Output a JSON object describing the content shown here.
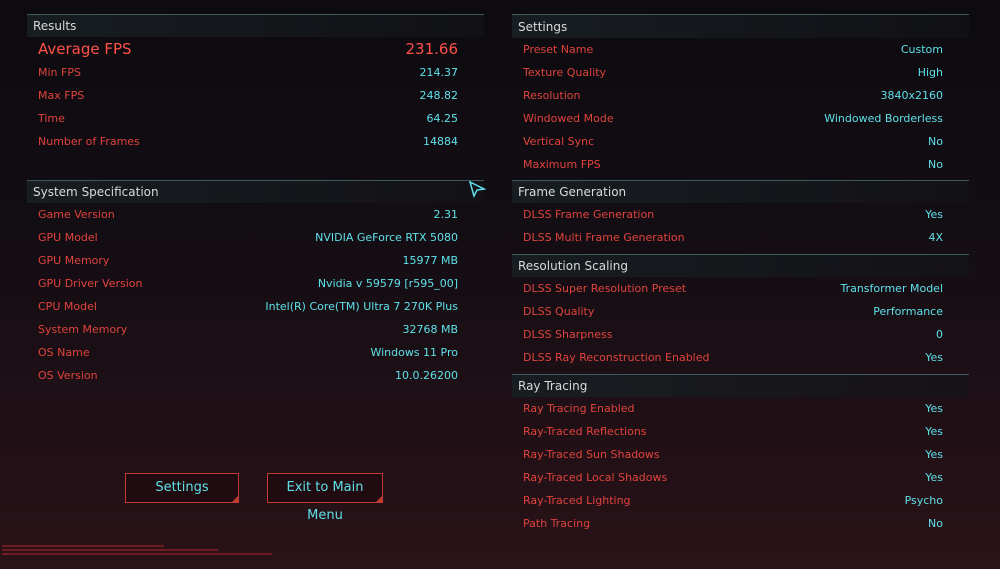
{
  "results": {
    "header": "Results",
    "average": {
      "label": "Average FPS",
      "value": "231.66"
    },
    "rows": [
      {
        "label": "Min FPS",
        "value": "214.37"
      },
      {
        "label": "Max FPS",
        "value": "248.82"
      },
      {
        "label": "Time",
        "value": "64.25"
      },
      {
        "label": "Number of Frames",
        "value": "14884"
      }
    ]
  },
  "system": {
    "header": "System Specification",
    "rows": [
      {
        "label": "Game Version",
        "value": "2.31"
      },
      {
        "label": "GPU Model",
        "value": "NVIDIA GeForce RTX 5080"
      },
      {
        "label": "GPU Memory",
        "value": "15977 MB"
      },
      {
        "label": "GPU Driver Version",
        "value": "Nvidia v 59579 [r595_00]"
      },
      {
        "label": "CPU Model",
        "value": "Intel(R) Core(TM) Ultra 7 270K Plus"
      },
      {
        "label": "System Memory",
        "value": "32768 MB"
      },
      {
        "label": "OS Name",
        "value": "Windows 11 Pro"
      },
      {
        "label": "OS Version",
        "value": "10.0.26200"
      }
    ]
  },
  "settings": {
    "header": "Settings",
    "rows": [
      {
        "label": "Preset Name",
        "value": "Custom"
      },
      {
        "label": "Texture Quality",
        "value": "High"
      },
      {
        "label": "Resolution",
        "value": "3840x2160"
      },
      {
        "label": "Windowed Mode",
        "value": "Windowed Borderless"
      },
      {
        "label": "Vertical Sync",
        "value": "No"
      },
      {
        "label": "Maximum FPS",
        "value": "No"
      }
    ]
  },
  "frame_generation": {
    "header": "Frame Generation",
    "rows": [
      {
        "label": "DLSS Frame Generation",
        "value": "Yes"
      },
      {
        "label": "DLSS Multi Frame Generation",
        "value": "4X"
      }
    ]
  },
  "resolution_scaling": {
    "header": "Resolution Scaling",
    "rows": [
      {
        "label": "DLSS Super Resolution Preset",
        "value": "Transformer Model"
      },
      {
        "label": "DLSS Quality",
        "value": "Performance"
      },
      {
        "label": "DLSS Sharpness",
        "value": "0"
      },
      {
        "label": "DLSS Ray Reconstruction Enabled",
        "value": "Yes"
      }
    ]
  },
  "ray_tracing": {
    "header": "Ray Tracing",
    "rows": [
      {
        "label": "Ray Tracing Enabled",
        "value": "Yes"
      },
      {
        "label": "Ray-Traced Reflections",
        "value": "Yes"
      },
      {
        "label": "Ray-Traced Sun Shadows",
        "value": "Yes"
      },
      {
        "label": "Ray-Traced Local Shadows",
        "value": "Yes"
      },
      {
        "label": "Ray-Traced Lighting",
        "value": "Psycho"
      },
      {
        "label": "Path Tracing",
        "value": "No"
      }
    ]
  },
  "buttons": {
    "settings": "Settings",
    "exit": "Exit to Main Menu"
  },
  "icons": {
    "cursor": "cursor-arrow-icon"
  },
  "colors": {
    "label": "#e0433c",
    "value": "#5fe1ea",
    "accent": "#ff5147",
    "border": "#c23a34"
  }
}
